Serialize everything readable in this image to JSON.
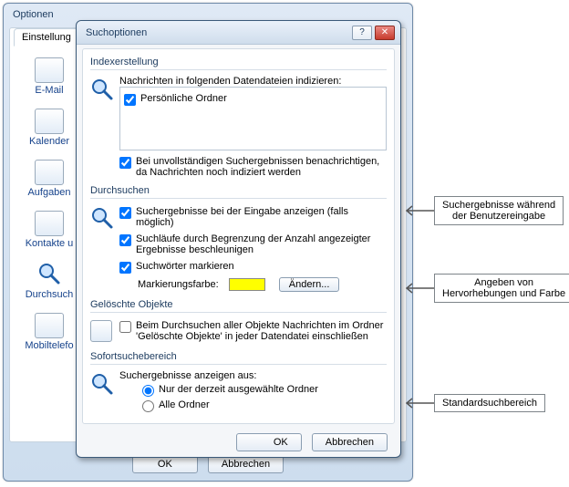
{
  "back": {
    "title": "Optionen",
    "tab": "Einstellung",
    "footer": {
      "ok": "OK",
      "cancel": "Abbrechen"
    },
    "sidebar": [
      {
        "label": "E-Mail"
      },
      {
        "label": "Kalender"
      },
      {
        "label": "Aufgaben"
      },
      {
        "label": "Kontakte u"
      },
      {
        "label": "Durchsuch"
      },
      {
        "label": "Mobiltelefo"
      }
    ]
  },
  "dlg": {
    "title": "Suchoptionen",
    "help_glyph": "?",
    "close_glyph": "✕",
    "footer": {
      "ok": "OK",
      "cancel": "Abbrechen"
    },
    "groups": {
      "indexing": {
        "title": "Indexerstellung",
        "intro": "Nachrichten in folgenden Datendateien indizieren:",
        "list_item": "Persönliche Ordner",
        "notify": "Bei unvollständigen Suchergebnissen benachrichtigen, da Nachrichten noch indiziert werden"
      },
      "search": {
        "title": "Durchsuchen",
        "live": "Suchergebnisse bei der Eingabe anzeigen (falls möglich)",
        "limit": "Suchläufe durch Begrenzung der Anzahl angezeigter Ergebnisse beschleunigen",
        "highlight": "Suchwörter markieren",
        "color_label": "Markierungsfarbe:",
        "change_btn": "Ändern...",
        "highlight_color": "#ffff00"
      },
      "deleted": {
        "title": "Gelöschte Objekte",
        "include": "Beim Durchsuchen aller Objekte Nachrichten im Ordner 'Gelöschte Objekte' in jeder Datendatei einschließen"
      },
      "scope": {
        "title": "Sofortsuchebereich",
        "intro": "Suchergebnisse anzeigen aus:",
        "opt_current": "Nur der derzeit ausgewählte Ordner",
        "opt_all": "Alle Ordner"
      }
    }
  },
  "callouts": {
    "c1a": "Suchergebnisse während",
    "c1b": "der Benutzereingabe",
    "c2a": "Angeben von",
    "c2b": "Hervorhebungen und Farbe",
    "c3": "Standardsuchbereich"
  }
}
